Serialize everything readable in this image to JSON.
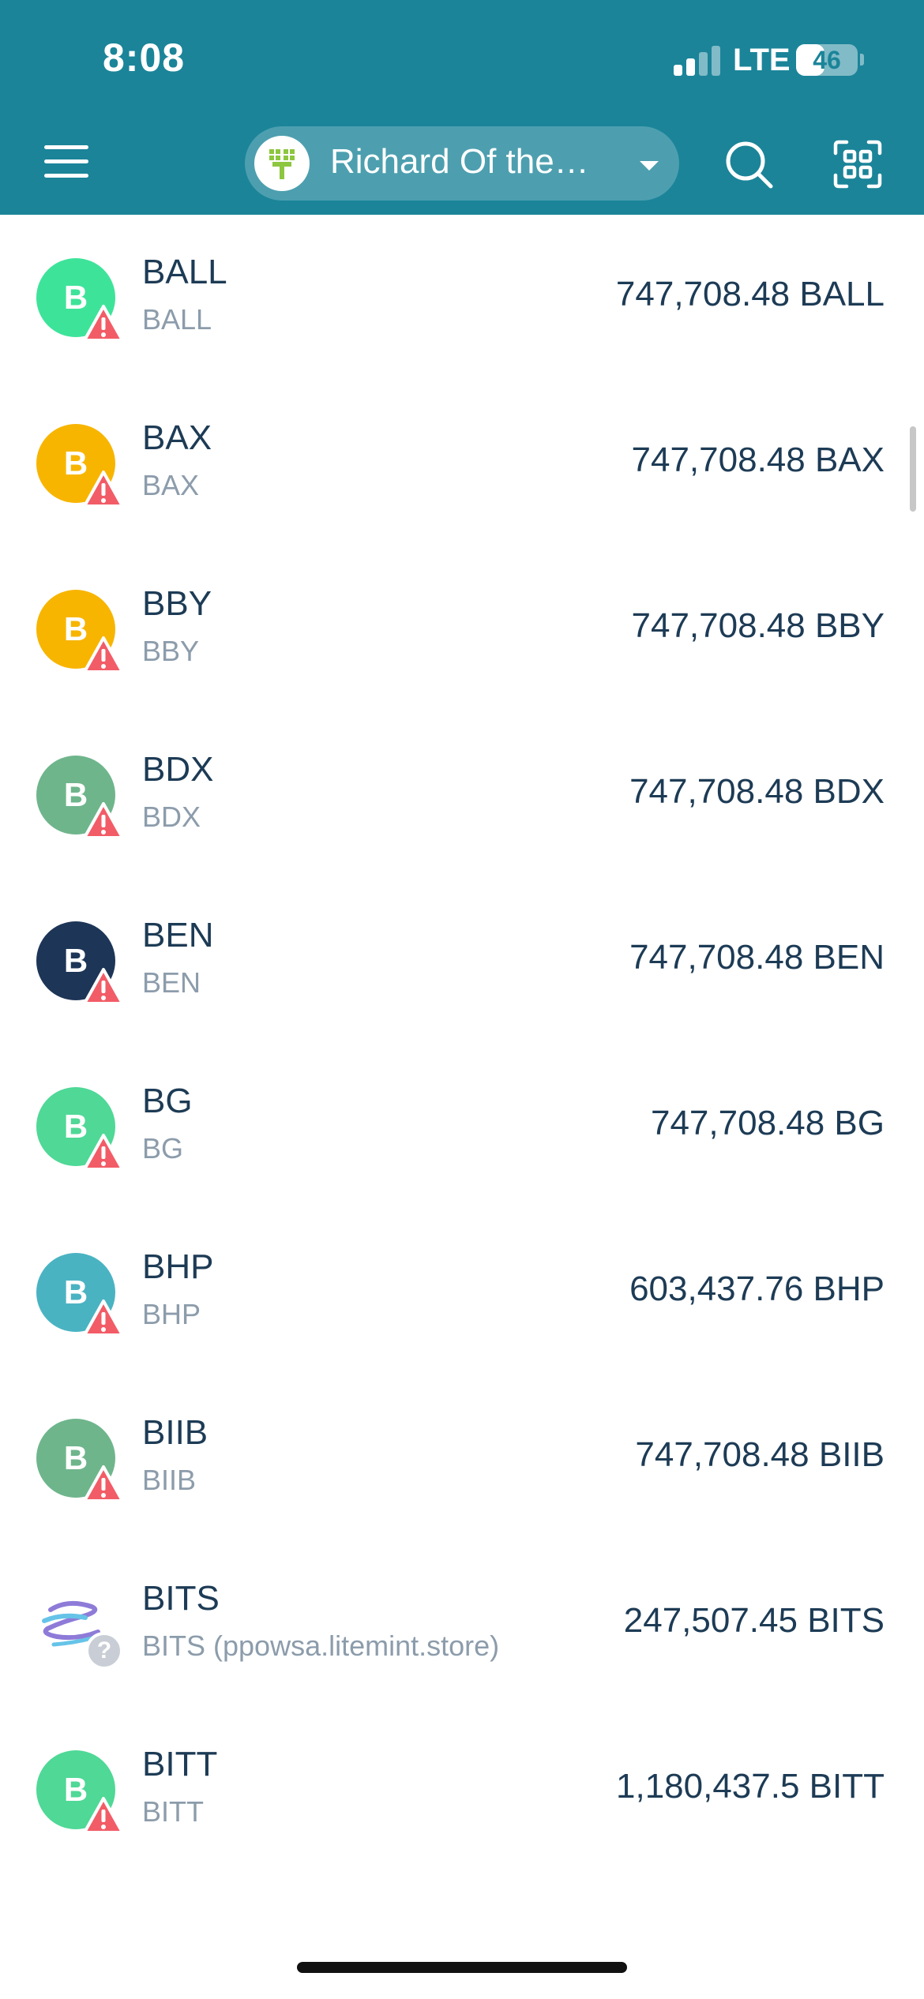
{
  "status_bar": {
    "time": "8:08",
    "network": "LTE",
    "battery": "46",
    "battery_level": 0.46
  },
  "header": {
    "account_name": "Richard Of the…",
    "icons": {
      "menu": "hamburger-menu-icon",
      "avatar": "account-tree-icon",
      "caret": "chevron-down-icon",
      "search": "search-icon",
      "scan": "qr-scan-icon"
    },
    "colors": {
      "background": "#1b8499",
      "avatar_accent": "#8dc63f"
    }
  },
  "assets": [
    {
      "letter": "B",
      "code": "BALL",
      "issuer": "BALL",
      "balance": "747,708.48 BALL",
      "color": "#3ee39a",
      "badge": "warning"
    },
    {
      "letter": "B",
      "code": "BAX",
      "issuer": "BAX",
      "balance": "747,708.48 BAX",
      "color": "#f7b500",
      "badge": "warning"
    },
    {
      "letter": "B",
      "code": "BBY",
      "issuer": "BBY",
      "balance": "747,708.48 BBY",
      "color": "#f7b500",
      "badge": "warning"
    },
    {
      "letter": "B",
      "code": "BDX",
      "issuer": "BDX",
      "balance": "747,708.48 BDX",
      "color": "#6fb58c",
      "badge": "warning"
    },
    {
      "letter": "B",
      "code": "BEN",
      "issuer": "BEN",
      "balance": "747,708.48 BEN",
      "color": "#1d3557",
      "badge": "warning"
    },
    {
      "letter": "B",
      "code": "BG",
      "issuer": "BG",
      "balance": "747,708.48 BG",
      "color": "#4fd896",
      "badge": "warning"
    },
    {
      "letter": "B",
      "code": "BHP",
      "issuer": "BHP",
      "balance": "603,437.76 BHP",
      "color": "#4ab3c2",
      "badge": "warning"
    },
    {
      "letter": "B",
      "code": "BIIB",
      "issuer": "BIIB",
      "balance": "747,708.48 BIIB",
      "color": "#6fb58c",
      "badge": "warning"
    },
    {
      "letter": "",
      "code": "BITS",
      "issuer": "BITS (ppowsa.litemint.store)",
      "balance": "247,507.45 BITS",
      "color": "#ffffff",
      "badge": "unknown",
      "badge_glyph": "?"
    },
    {
      "letter": "B",
      "code": "BITT",
      "issuer": "BITT",
      "balance": "1,180,437.5 BITT",
      "color": "#4fd896",
      "badge": "warning"
    }
  ],
  "badge_colors": {
    "warning": "#f25c67",
    "unknown": "#c9ced6"
  }
}
